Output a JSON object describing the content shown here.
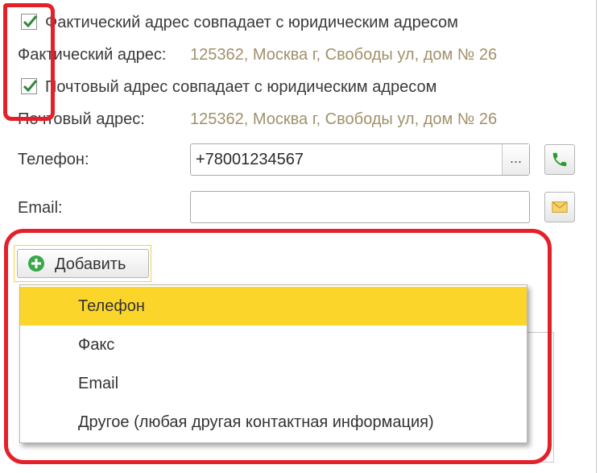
{
  "actual_address": {
    "checkbox_label": "Фактический адрес совпадает с юридическим адресом",
    "checked": true,
    "label": "Фактический адрес:",
    "value": "125362, Москва г, Свободы ул, дом № 26"
  },
  "postal_address": {
    "checkbox_label": "Почтовый адрес совпадает с юридическим адресом",
    "checked": true,
    "label": "Почтовый адрес:",
    "value": "125362, Москва г, Свободы ул, дом № 26"
  },
  "phone": {
    "label": "Телефон:",
    "value": "+78001234567",
    "select_button": "...",
    "call_icon": "phone-icon"
  },
  "email": {
    "label": "Email:",
    "value": "",
    "mail_icon": "envelope-icon"
  },
  "add_button": {
    "label": "Добавить",
    "icon": "plus-circle-icon"
  },
  "add_menu": {
    "items": [
      {
        "label": "Телефон",
        "selected": true
      },
      {
        "label": "Факс",
        "selected": false
      },
      {
        "label": "Email",
        "selected": false
      },
      {
        "label": "Другое (любая другая контактная информация)",
        "selected": false
      }
    ]
  },
  "colors": {
    "value_text": "#a0916a",
    "highlight": "#fbd52a",
    "annotation_red": "#e4202a",
    "phone_green": "#2e9a2e"
  }
}
